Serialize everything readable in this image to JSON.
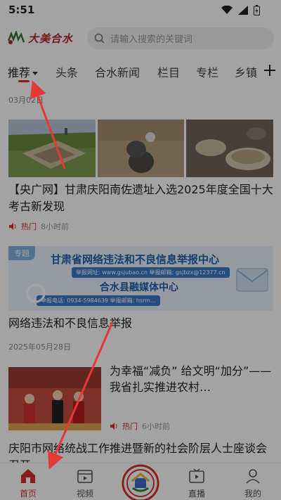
{
  "status_bar": {
    "time": "5:51"
  },
  "header": {
    "logo_text": "大美合水",
    "search_placeholder": "请输入搜索的关键词"
  },
  "tabs": [
    {
      "label": "推荐",
      "active": true
    },
    {
      "label": "头条"
    },
    {
      "label": "合水新闻"
    },
    {
      "label": "栏目"
    },
    {
      "label": "专栏"
    },
    {
      "label": "乡镇"
    }
  ],
  "feed": {
    "article1": {
      "date": "03月02日",
      "title": "【央广网】甘肃庆阳南佐遗址入选2025年度全国十大考古新发现",
      "hot": "热门",
      "time": "8小时前"
    },
    "banner": {
      "tag": "专题",
      "line1": "甘肃省网络违法和不良信息举报中心",
      "line2": "举报网址: www.gsjubao.cn  举报邮箱: gsjbzx@12377.cn",
      "line3": "合水县融媒体中心",
      "line4": "举报电话: 0934-5984639  举报邮箱: hsrm..."
    },
    "article2": {
      "title": "网络违法和不良信息举报",
      "date": "2025年05月28日"
    },
    "article3": {
      "title": "为幸福“减负” 给文明“加分”——我省扎实推进农村…",
      "hot": "热门",
      "time": "6小时前"
    },
    "article4": {
      "title": "庆阳市网络统战工作推进暨新的社会阶层人士座谈会召开"
    }
  },
  "bottom_nav": [
    {
      "label": "首页",
      "icon": "home-icon",
      "active": true
    },
    {
      "label": "视频",
      "icon": "video-icon"
    },
    {
      "label": "",
      "icon": "center-logo-icon"
    },
    {
      "label": "直播",
      "icon": "live-icon"
    },
    {
      "label": "我的",
      "icon": "user-icon"
    }
  ],
  "colors": {
    "accent": "#d8312a",
    "banner_blue": "#1f5fae"
  }
}
